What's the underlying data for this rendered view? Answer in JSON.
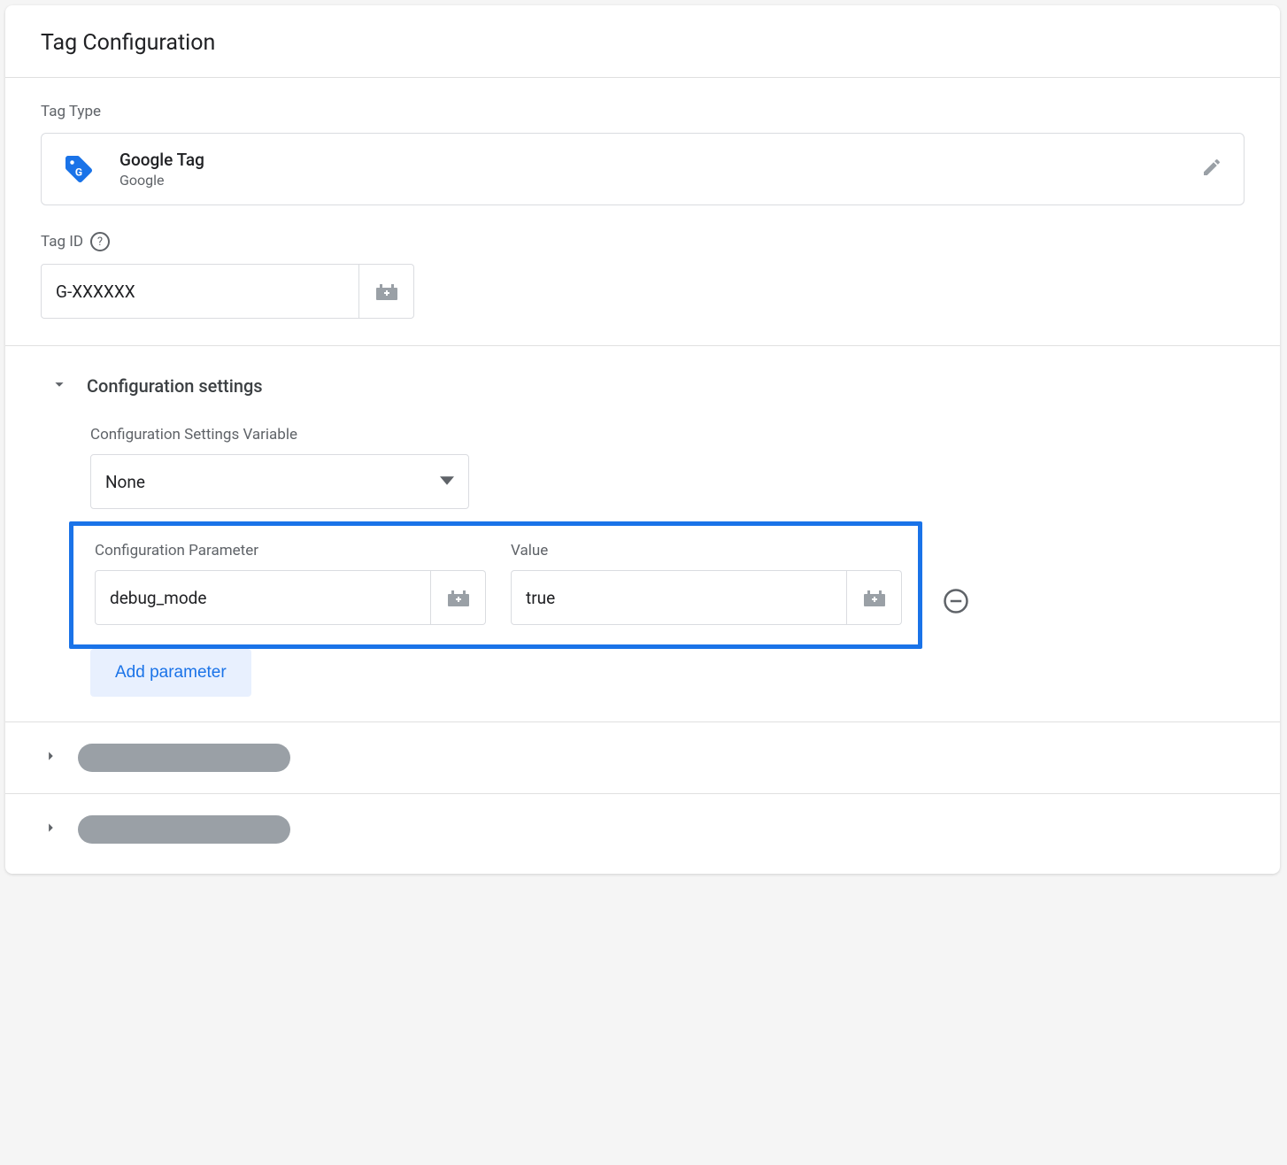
{
  "header": {
    "title": "Tag Configuration"
  },
  "tagType": {
    "label": "Tag Type",
    "name": "Google Tag",
    "vendor": "Google"
  },
  "tagId": {
    "label": "Tag ID",
    "value": "G-XXXXXX"
  },
  "configSection": {
    "title": "Configuration settings",
    "variableLabel": "Configuration Settings Variable",
    "variableValue": "None",
    "paramLabel": "Configuration Parameter",
    "valueLabel": "Value",
    "parameters": [
      {
        "name": "debug_mode",
        "value": "true"
      }
    ],
    "addButton": "Add parameter"
  }
}
